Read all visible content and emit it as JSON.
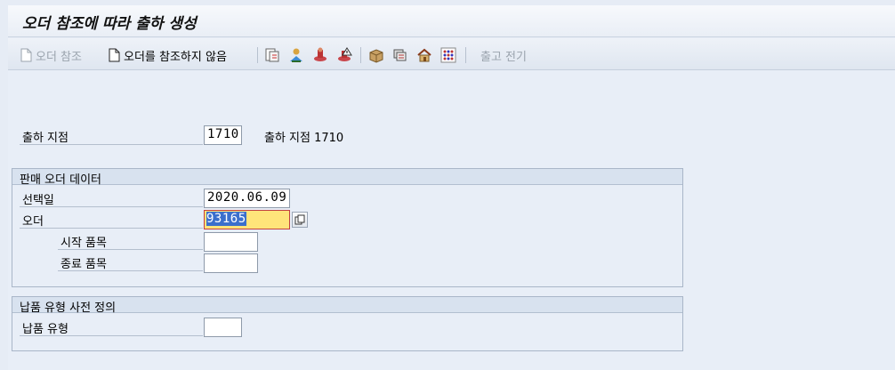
{
  "window": {
    "title": "오더 참조에 따라 출하 생성"
  },
  "toolbar": {
    "order_ref_label": "오더 참조",
    "no_order_ref_label": "오더를 참조하지 않음",
    "posting_label": "출고 전기",
    "icons": [
      "document-copy-icon",
      "user-select-icon",
      "stamp-icon",
      "alert-stamp-icon",
      "package-icon",
      "transport-icon",
      "house-icon",
      "grid-dots-icon"
    ]
  },
  "shipping_point": {
    "label": "출하 지점",
    "value": "1710",
    "description": "출하 지점 1710"
  },
  "sales_order_group": {
    "title": "판매 오더 데이터",
    "selection_date_label": "선택일",
    "selection_date_value": "2020.06.09",
    "order_label": "오더",
    "order_value": "93165",
    "from_item_label": "시작 품목",
    "from_item_value": "",
    "to_item_label": "종료 품목",
    "to_item_value": ""
  },
  "delivery_type_group": {
    "title": "납품 유형 사전 정의",
    "delivery_type_label": "납품 유형",
    "delivery_type_value": ""
  },
  "colors": {
    "active_field": "#ffe47a",
    "selection": "#3b6fcc",
    "background": "#e8eef7"
  }
}
